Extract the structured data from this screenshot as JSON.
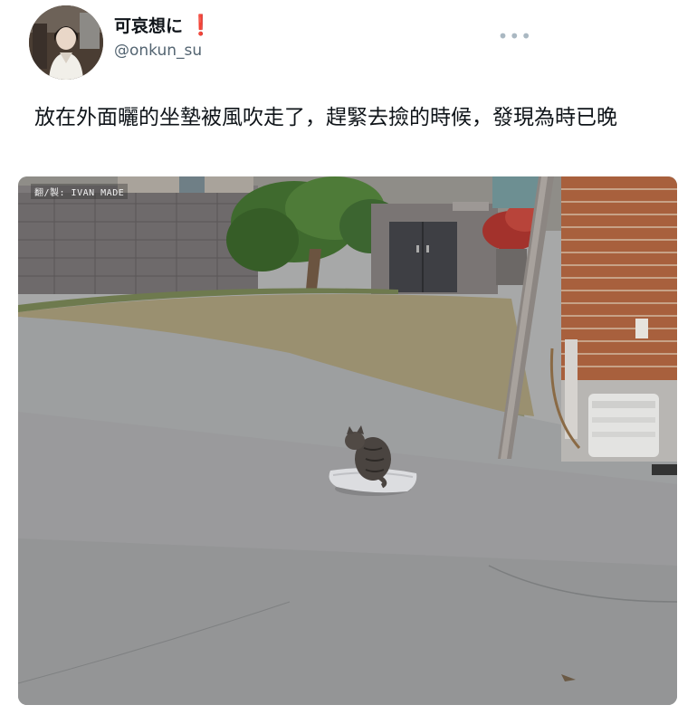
{
  "tweet": {
    "display_name": "可哀想に",
    "badge_glyph": "❗",
    "handle": "@onkun_su",
    "more_glyph": "•••",
    "text": "放在外面曬的坐墊被風吹走了，趕緊去撿的時候，發現為時已晚"
  },
  "media": {
    "watermark": "翻/製: IVAN MADE",
    "icons": {
      "avatar": "profile-photo",
      "more": "more-options-icon"
    }
  },
  "colors": {
    "badge": "#e0243c",
    "handle": "#536471",
    "text": "#0f1419"
  }
}
